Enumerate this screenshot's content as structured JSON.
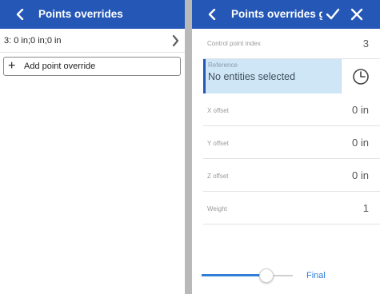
{
  "left": {
    "header": {
      "title": "Points overrides",
      "back_icon": "chevron-left-icon"
    },
    "override_row": {
      "text": "3: 0 in;0 in;0 in",
      "icon": "chevron-right-icon"
    },
    "add_button": {
      "icon": "plus-icon",
      "label": "Add point override"
    }
  },
  "right": {
    "header": {
      "title": "Points overrides gr",
      "back_icon": "chevron-left-icon",
      "confirm_icon": "checkmark-icon",
      "close_icon": "close-icon"
    },
    "fields": {
      "control_point_index": {
        "label": "Control point index",
        "value": "3"
      },
      "reference": {
        "label": "Reference",
        "value": "No entities selected",
        "icon": "clock-selection-icon"
      },
      "x_offset": {
        "label": "X offset",
        "value": "0 in"
      },
      "y_offset": {
        "label": "Y offset",
        "value": "0 in"
      },
      "z_offset": {
        "label": "Z offset",
        "value": "0 in"
      },
      "weight": {
        "label": "Weight",
        "value": "1"
      }
    },
    "slider": {
      "level": 0.71
    },
    "final_label": "Final"
  },
  "colors": {
    "header_bg": "#2557b6",
    "selected_field_bg": "#cfe6f7",
    "accent": "#2f7fd7",
    "divider_bg": "#b9b9b9"
  }
}
